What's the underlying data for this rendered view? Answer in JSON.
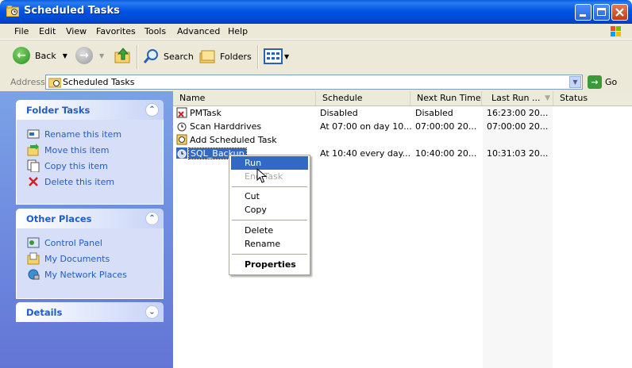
{
  "window": {
    "title": "Scheduled Tasks"
  },
  "menubar": [
    "File",
    "Edit",
    "View",
    "Favorites",
    "Tools",
    "Advanced",
    "Help"
  ],
  "toolbar": {
    "back": "Back",
    "search": "Search",
    "folders": "Folders"
  },
  "address": {
    "label": "Address",
    "value": "Scheduled Tasks",
    "go": "Go"
  },
  "folder_tasks": {
    "title": "Folder Tasks",
    "items": [
      "Rename this item",
      "Move this item",
      "Copy this item",
      "Delete this item"
    ]
  },
  "other_places": {
    "title": "Other Places",
    "items": [
      "Control Panel",
      "My Documents",
      "My Network Places"
    ]
  },
  "details": {
    "title": "Details"
  },
  "columns": [
    "Name",
    "Schedule",
    "Next Run Time",
    "Last Run ...",
    "Status"
  ],
  "rows": [
    {
      "name": "PMTask",
      "schedule": "Disabled",
      "next": "Disabled",
      "last": "16:23:00  20...",
      "status": "",
      "icon": "disabled-task-icon"
    },
    {
      "name": "Scan Harddrives",
      "schedule": "At 07:00 on day 10...",
      "next": "07:00:00  20...",
      "last": "07:00:00  20...",
      "status": "",
      "icon": "clock-task-icon"
    },
    {
      "name": "Add Scheduled Task",
      "schedule": "",
      "next": "",
      "last": "",
      "status": "",
      "icon": "add-task-wizard-icon"
    },
    {
      "name": "SQL_Backup",
      "schedule": "At 10:40 every day...",
      "next": "10:40:00  20...",
      "last": "10:31:03  20...",
      "status": "",
      "icon": "clock-task-icon"
    }
  ],
  "context_menu": {
    "run": "Run",
    "end_task": "End Task",
    "cut": "Cut",
    "copy": "Copy",
    "delete": "Delete",
    "rename": "Rename",
    "properties": "Properties"
  },
  "colors": {
    "titlebar": "#0055e5",
    "selection": "#316ac5",
    "panel_link": "#215dc6"
  }
}
